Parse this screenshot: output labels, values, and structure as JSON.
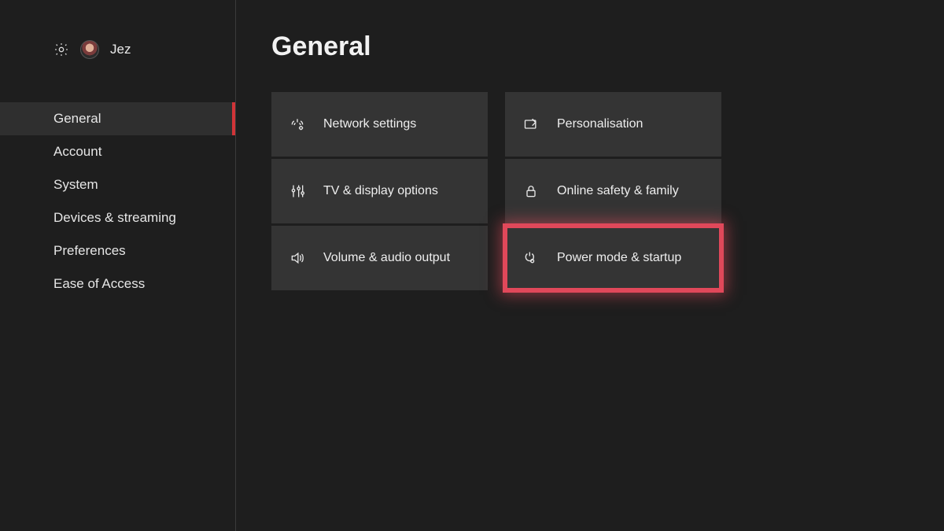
{
  "user": {
    "name": "Jez"
  },
  "sidebar": {
    "items": [
      {
        "label": "General",
        "active": true
      },
      {
        "label": "Account"
      },
      {
        "label": "System"
      },
      {
        "label": "Devices & streaming"
      },
      {
        "label": "Preferences"
      },
      {
        "label": "Ease of Access"
      }
    ]
  },
  "page": {
    "title": "General"
  },
  "tiles": [
    {
      "icon": "network-icon",
      "label": "Network settings"
    },
    {
      "icon": "personalise-icon",
      "label": "Personalisation"
    },
    {
      "icon": "tv-icon",
      "label": "TV & display options"
    },
    {
      "icon": "lock-icon",
      "label": "Online safety & family"
    },
    {
      "icon": "volume-icon",
      "label": "Volume & audio output"
    },
    {
      "icon": "power-icon",
      "label": "Power mode & startup",
      "highlight": true
    }
  ]
}
